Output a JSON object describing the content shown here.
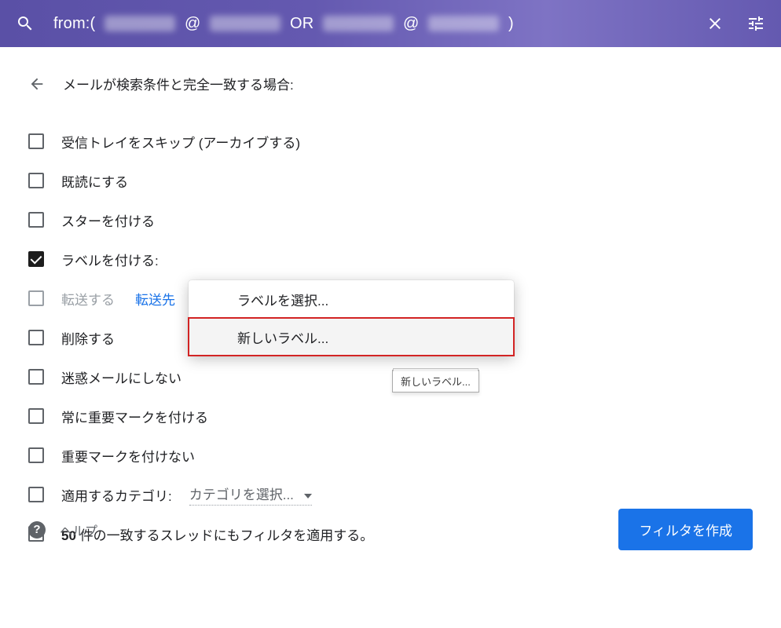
{
  "search": {
    "prefix": "from:(",
    "at": "@",
    "or": "OR",
    "suffix": ")"
  },
  "panel": {
    "title": "メールが検索条件と完全一致する場合:"
  },
  "options": [
    {
      "label": "受信トレイをスキップ (アーカイブする)",
      "checked": false
    },
    {
      "label": "既読にする",
      "checked": false
    },
    {
      "label": "スターを付ける",
      "checked": false
    },
    {
      "label": "ラベルを付ける:",
      "checked": true
    },
    {
      "label": "転送する",
      "checked": false,
      "link": "転送先"
    },
    {
      "label": "削除する",
      "checked": false
    },
    {
      "label": "迷惑メールにしない",
      "checked": false
    },
    {
      "label": "常に重要マークを付ける",
      "checked": false
    },
    {
      "label": "重要マークを付けない",
      "checked": false
    },
    {
      "label_prefix": "適用するカテゴリ:",
      "select_text": "カテゴリを選択...",
      "checked": false
    },
    {
      "bold_prefix": "50",
      "label_suffix": " 件の一致するスレッドにもフィルタを適用する。",
      "checked": false
    }
  ],
  "dropdown": {
    "item_select": "ラベルを選択...",
    "item_new": "新しいラベル..."
  },
  "tooltip": "新しいラベル...",
  "footer": {
    "help": "ヘルプ",
    "create": "フィルタを作成"
  }
}
